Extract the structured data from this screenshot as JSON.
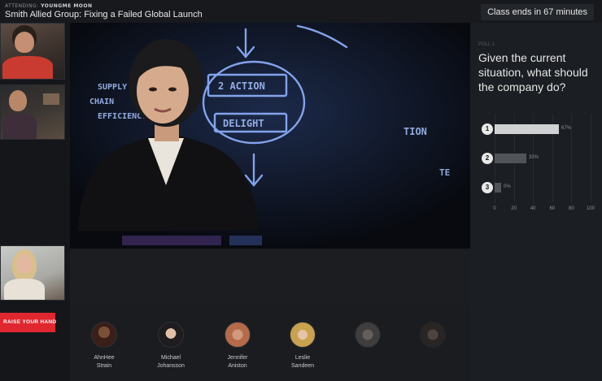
{
  "header": {
    "attending_label": "ATTENDING",
    "attending_name": "YOUNGME MOON",
    "session_title": "Smith Allied Group: Fixing a Failed Global Launch",
    "class_timer": "Class ends in 67 minutes"
  },
  "left_panel": {
    "raise_hand_label": "RAISE YOUR HAND",
    "note_1": "",
    "note_2": "",
    "note_3": ""
  },
  "poll": {
    "label": "POLL 1",
    "question": "Given the current situation, what should the company do?",
    "options": [
      {
        "num": "1",
        "pct_label": "67%"
      },
      {
        "num": "2",
        "pct_label": "33%"
      },
      {
        "num": "3",
        "pct_label": "0%"
      }
    ],
    "ticks": [
      "0",
      "20",
      "40",
      "60",
      "80",
      "100"
    ]
  },
  "chart_data": {
    "type": "bar",
    "orientation": "horizontal",
    "categories": [
      "1",
      "2",
      "3"
    ],
    "values": [
      67,
      33,
      0
    ],
    "title": "",
    "xlabel": "",
    "ylabel": "",
    "xlim": [
      0,
      100
    ]
  },
  "participants": [
    {
      "first": "AhnHee",
      "last": "Strain",
      "dim": false
    },
    {
      "first": "Michael",
      "last": "Johansson",
      "dim": false
    },
    {
      "first": "Jennifer",
      "last": "Aniston",
      "dim": false
    },
    {
      "first": "Leslie",
      "last": "Sandeen",
      "dim": false
    },
    {
      "first": "",
      "last": "",
      "dim": true
    },
    {
      "first": "",
      "last": "",
      "dim": true
    }
  ],
  "colors": {
    "accent_red": "#e0262f",
    "background": "#15171b",
    "poll_bar_top": "#cfd1d3",
    "poll_bar_other": "#505357"
  }
}
